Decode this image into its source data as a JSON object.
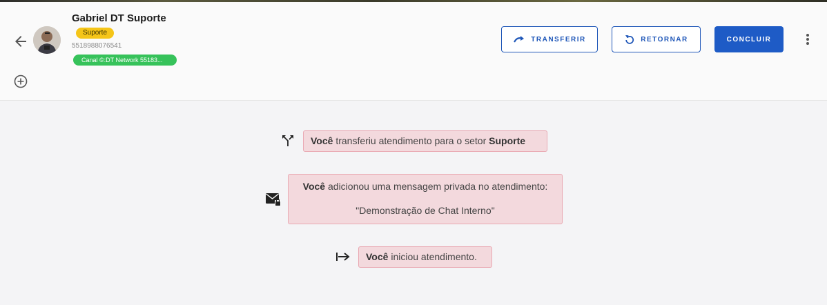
{
  "contact": {
    "name": "Gabriel DT Suporte",
    "tag": "Suporte",
    "phone": "5518988076541",
    "channel": "Canal ©:DT Network 55183..."
  },
  "actions": {
    "transfer_label": "TRANSFERIR",
    "return_label": "RETORNAR",
    "finish_label": "CONCLUIR"
  },
  "colors": {
    "primary": "#1e5bc6",
    "tag": "#f5c518",
    "channel": "#36c25a",
    "event_bg": "#f3d9dd",
    "event_border": "#e9a8b2"
  },
  "events": [
    {
      "icon": "transfer-arrows-icon",
      "actor": "Você",
      "text": " transferiu atendimento para o setor ",
      "target": "Suporte"
    },
    {
      "icon": "private-mail-lock-icon",
      "actor": "Você",
      "text": " adicionou uma mensagem privada no atendimento:",
      "quote": "\"Demonstração de Chat Interno\""
    },
    {
      "icon": "start-arrow-icon",
      "actor": "Você",
      "text": " iniciou atendimento."
    }
  ]
}
